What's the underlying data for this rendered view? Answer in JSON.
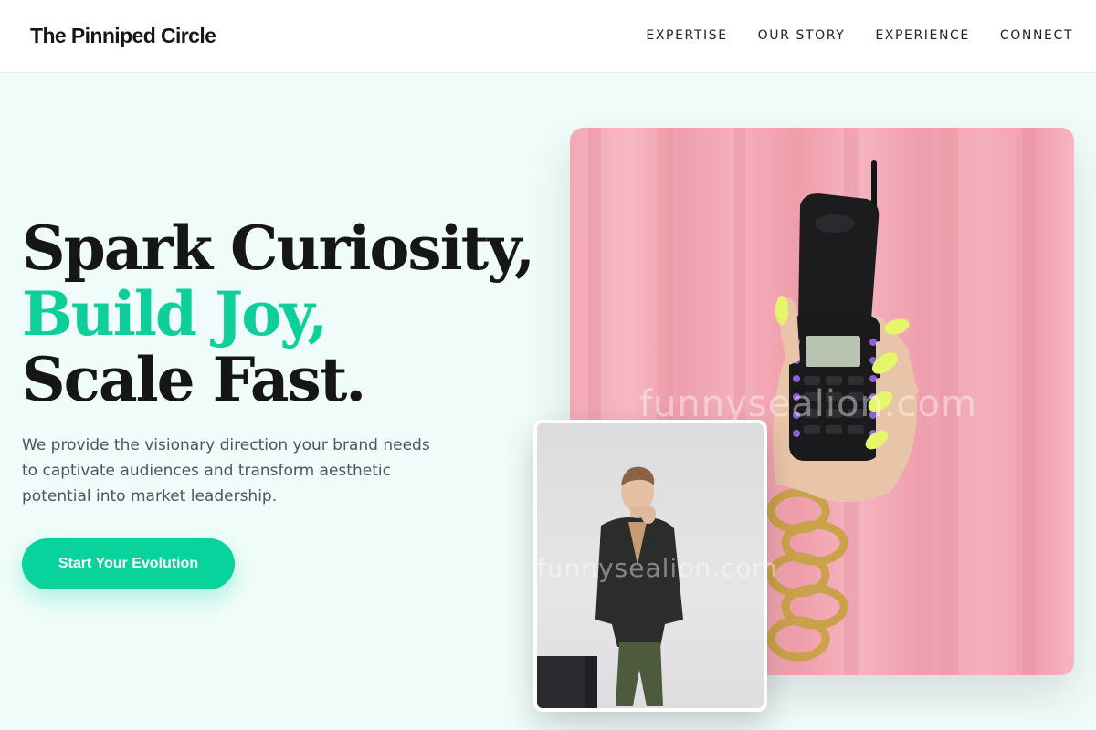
{
  "header": {
    "brand": "The Pinniped Circle",
    "nav": [
      "EXPERTISE",
      "OUR STORY",
      "EXPERIENCE",
      "CONNECT"
    ]
  },
  "hero": {
    "title_line1": "Spark Curiosity,",
    "title_line2": "Build Joy,",
    "title_line3": "Scale Fast.",
    "description": "We provide the visionary direction your brand needs to captivate audiences and transform aesthetic potential into market leadership.",
    "cta_label": "Start Your Evolution"
  },
  "images": {
    "main": "hand-holding-flip-phone-photo",
    "secondary": "man-in-blazer-photo"
  },
  "watermark": "funnysealion.com",
  "colors": {
    "accent": "#0ccf9a",
    "button": "#08d39c",
    "background": "#f0fcfa",
    "text": "#161616"
  }
}
